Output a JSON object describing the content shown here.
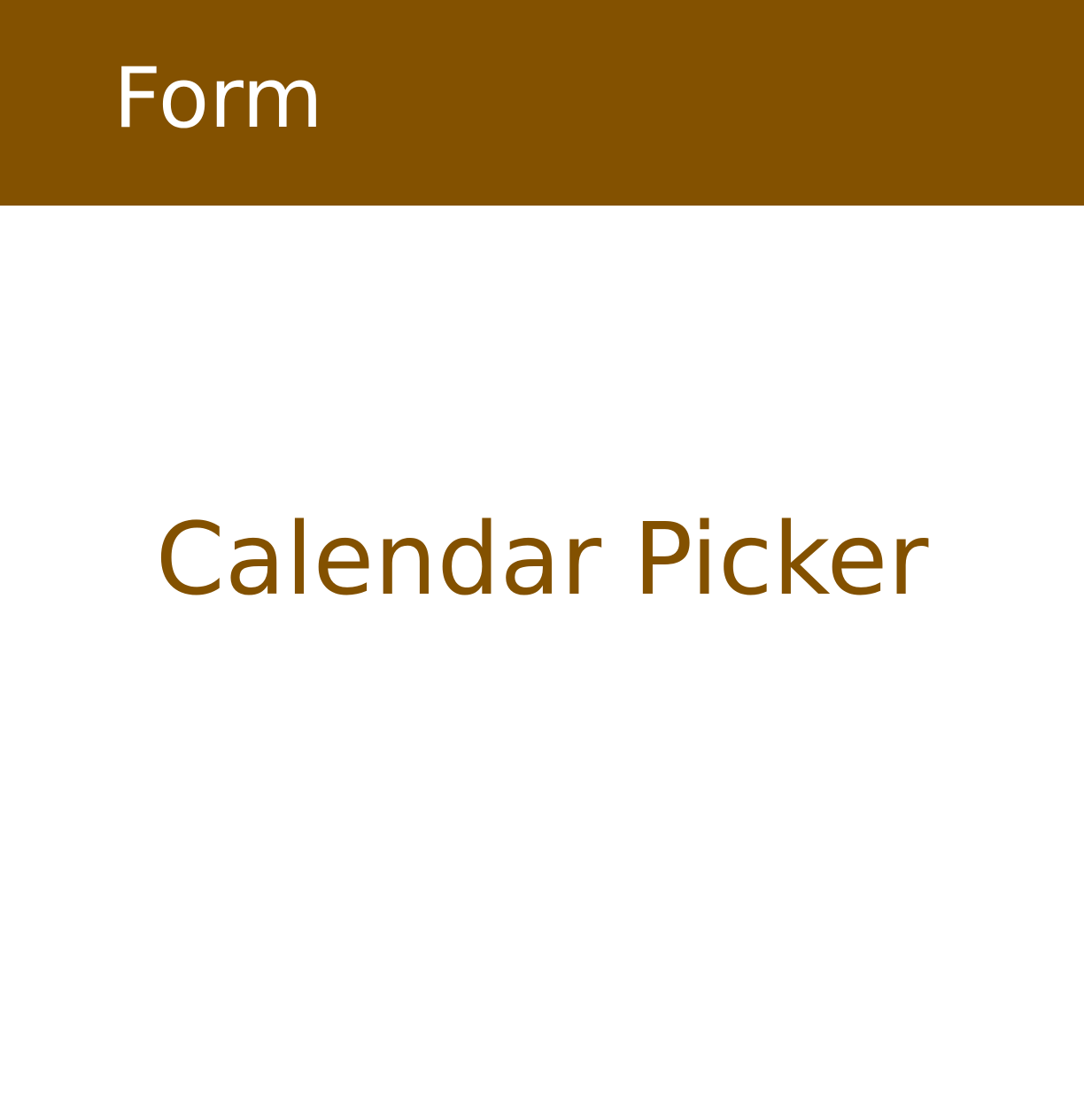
{
  "header": {
    "title": "Form",
    "background_color": "#835100",
    "text_color": "#ffffff"
  },
  "main": {
    "title": "Calendar Picker",
    "text_color": "#835100"
  }
}
